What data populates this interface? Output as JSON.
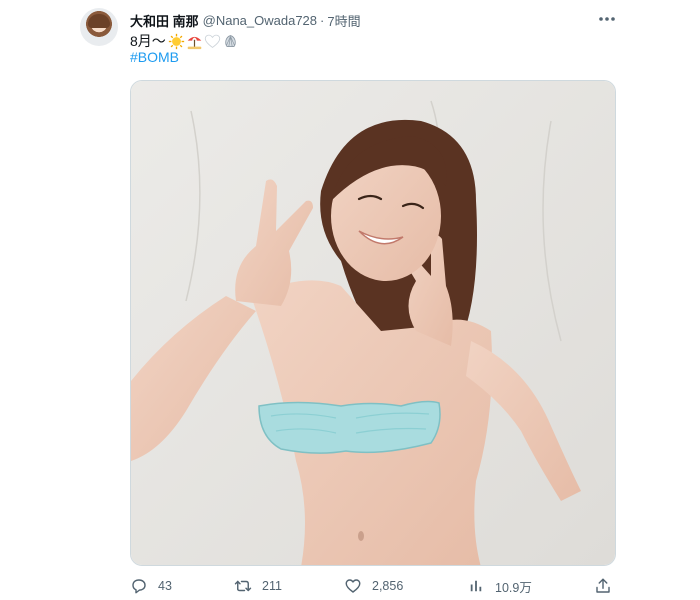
{
  "tweet": {
    "display_name": "大和田 南那",
    "handle": "@Nana_Owada728",
    "separator": "·",
    "time": "7時間",
    "text": "8月〜",
    "hashtag": "#BOMB",
    "emojis": [
      "sun-emoji",
      "beach-umbrella-emoji",
      "white-heart-emoji",
      "shell-emoji"
    ]
  },
  "actions": {
    "reply_count": "43",
    "retweet_count": "211",
    "like_count": "2,856",
    "views_count": "10.9万"
  },
  "icons": [
    "reply-icon",
    "retweet-icon",
    "like-icon",
    "views-icon",
    "share-icon",
    "more-icon"
  ],
  "colors": {
    "text": "#0f1419",
    "muted": "#536471",
    "link": "#1d9bf0",
    "bra": "#a9dcdf"
  }
}
